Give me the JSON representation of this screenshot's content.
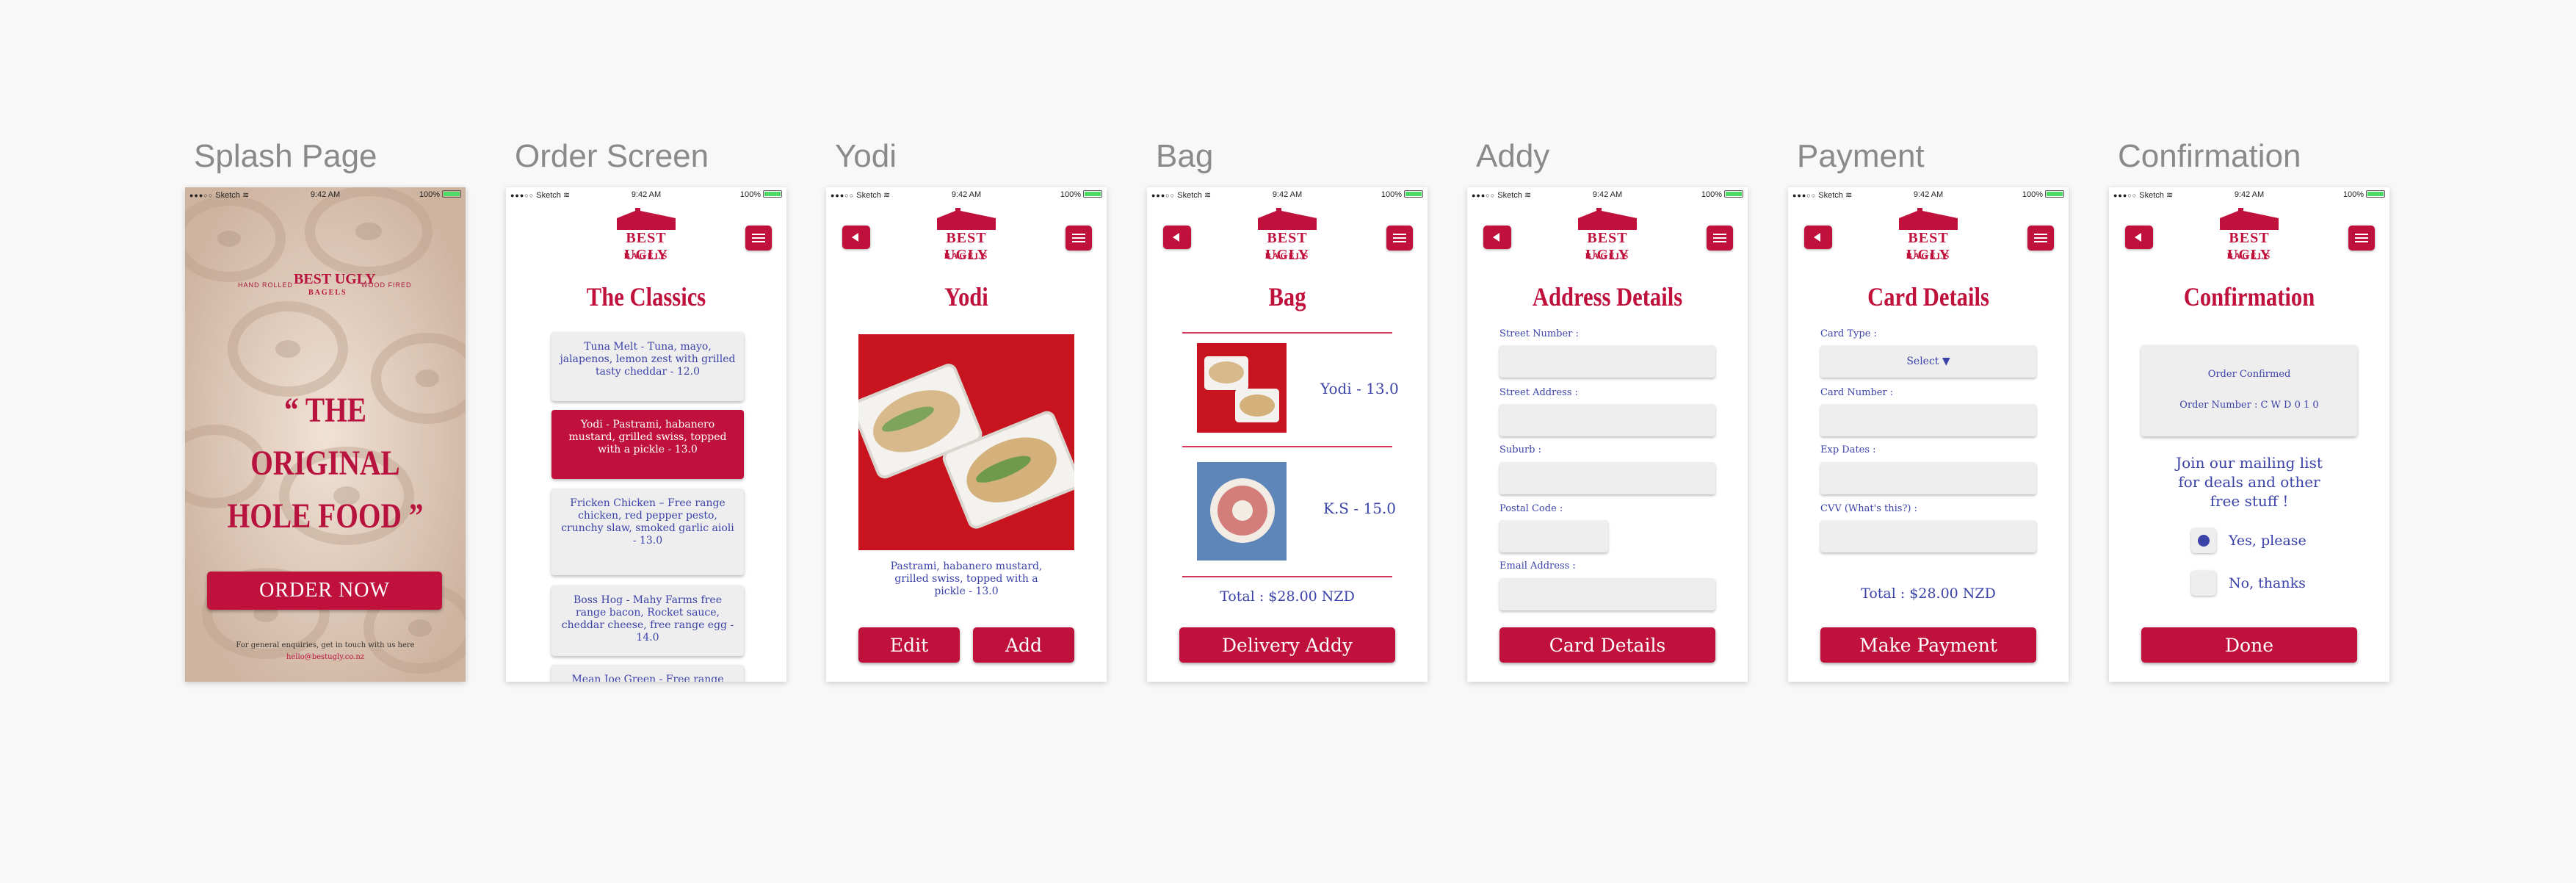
{
  "status": {
    "carrier": "Sketch",
    "wifi": "≋",
    "time": "9:42 AM",
    "battery": "100%"
  },
  "logo": {
    "name": "BEST UGLY",
    "sub": "BAGELS"
  },
  "splash": {
    "board_title": "Splash Page",
    "tagline_left": "HAND ROLLED",
    "tagline_right": "WOOD FIRED",
    "quote_line1": "“ THE ORIGINAL",
    "quote_line2": "HOLE FOOD ”",
    "order_button": "ORDER NOW",
    "enquiry": "For general enquiries, get in touch with us here",
    "email": "hello@bestugly.co.nz"
  },
  "order": {
    "board_title": "Order Screen",
    "title": "The Classics",
    "items": [
      "Tuna Melt - Tuna, mayo, jalapenos, lemon zest with grilled tasty cheddar - 12.0",
      "Yodi - Pastrami, habanero mustard, grilled swiss, topped with a pickle - 13.0",
      "Fricken Chicken – Free range chicken, red pepper pesto, crunchy slaw, smoked garlic aioli - 13.0",
      "Boss Hog - Mahy Farms free range bacon, Rocket sauce, cheddar cheese, free range egg - 14.0",
      "Mean Joe Green - Free range"
    ]
  },
  "yodi": {
    "board_title": "Yodi",
    "title": "Yodi",
    "description": "Pastrami, habanero mustard, grilled swiss, topped with a pickle - 13.0",
    "edit_button": "Edit",
    "add_button": "Add"
  },
  "bag": {
    "board_title": "Bag",
    "title": "Bag",
    "items": [
      {
        "label": "Yodi  - 13.0"
      },
      {
        "label": "K.S  - 15.0"
      }
    ],
    "total": "Total :  $28.00  NZD",
    "button": "Delivery Addy"
  },
  "addy": {
    "board_title": "Addy",
    "title": "Address Details",
    "fields": {
      "street_number": "Street Number :",
      "street_address": "Street Address :",
      "suburb": "Suburb :",
      "postal_code": "Postal Code :",
      "email": "Email Address :"
    },
    "button": "Card Details"
  },
  "payment": {
    "board_title": "Payment",
    "title": "Card Details",
    "fields": {
      "card_type": "Card Type :",
      "card_type_value": "Select ▼",
      "card_number": "Card Number :",
      "exp_dates": "Exp Dates :",
      "cvv": "CVV (What's this?) :"
    },
    "total": "Total :  $28.00  NZD",
    "button": "Make Payment"
  },
  "confirm": {
    "board_title": "Confirmation",
    "title": "Confirmation",
    "confirmed": "Order Confirmed",
    "order_number": "Order Number : C W D 0 1 0",
    "mailing": "Join our mailing list for deals and other free stuff !",
    "yes": "Yes, please",
    "no": "No, thanks",
    "button": "Done"
  },
  "colors": {
    "brand": "#c0103c",
    "text_blue": "#3b42a8",
    "card_bg": "#eeeeee"
  }
}
